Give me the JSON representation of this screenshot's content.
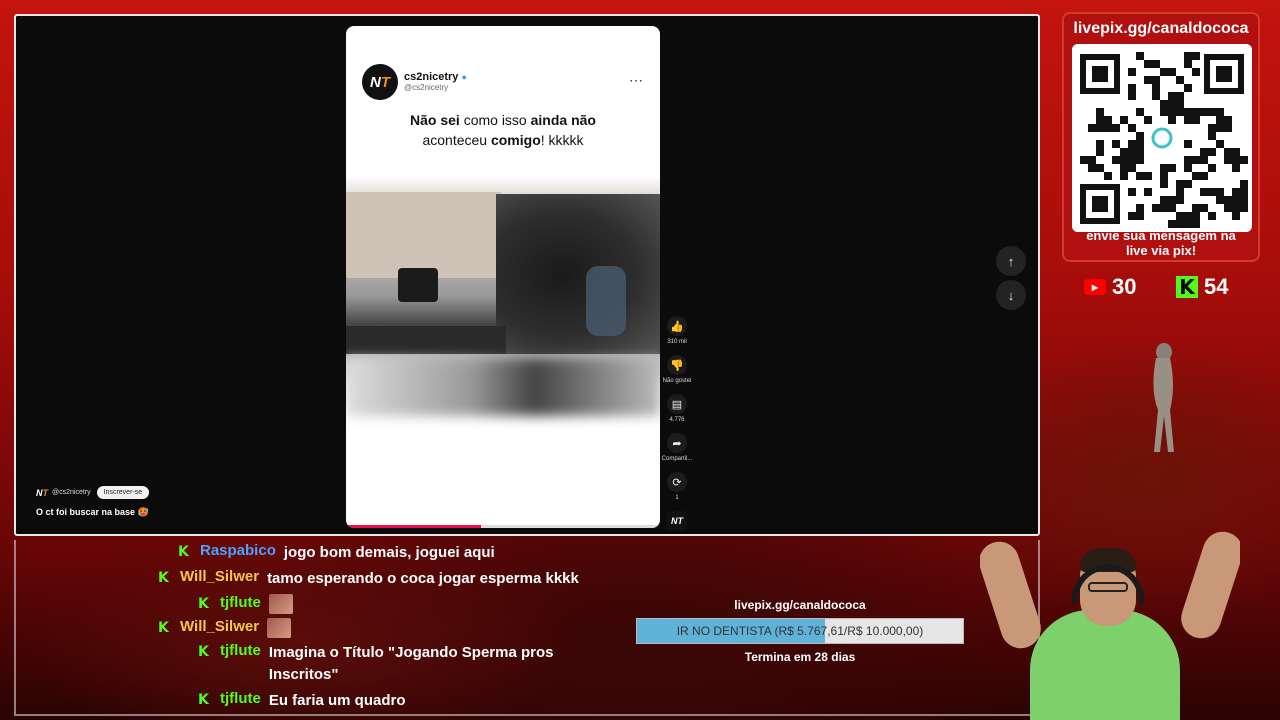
{
  "short": {
    "channel_name": "cs2nicetry",
    "channel_handle": "@cs2nicetry",
    "logo_text": "NT",
    "caption_line1_a": "Não sei",
    "caption_line1_b": " como isso ",
    "caption_line1_c": "ainda não",
    "caption_line2_a": "aconteceu ",
    "caption_line2_b": "comigo",
    "caption_line2_c": "! kkkkk",
    "progress": 0.43,
    "more_icon": "⋯",
    "actions": [
      {
        "icon": "thumbs-up-icon",
        "glyph": "👍",
        "label": "310 mil"
      },
      {
        "icon": "thumbs-down-icon",
        "glyph": "👎",
        "label": "Não gostei"
      },
      {
        "icon": "comment-icon",
        "glyph": "▤",
        "label": "4.776"
      },
      {
        "icon": "share-icon",
        "glyph": "➦",
        "label": "Compartil..."
      },
      {
        "icon": "remix-icon",
        "glyph": "⟳",
        "label": "1"
      }
    ]
  },
  "nav": {
    "up": "↑",
    "down": "↓"
  },
  "overlay": {
    "handle": "@cs2nicetry",
    "subscribe": "Inscrever-se",
    "comment": "O ct foi buscar na base 🥵"
  },
  "qr": {
    "url": "livepix.gg/canaldococa",
    "message_line1": "envie sua mensagem na",
    "message_line2": "live via pix!"
  },
  "counters": {
    "youtube": "30",
    "kick": "54",
    "youtube_color": "#ff0000",
    "kick_color": "#53fc18"
  },
  "chat": [
    {
      "user": "Raspabico",
      "color": "#4aa3ff",
      "text": "jogo bom demais, joguei aqui",
      "emote": false
    },
    {
      "user": "Will_Silwer",
      "color": "#f2c84b",
      "text": "tamo esperando o coca jogar esperma kkkk",
      "emote": false
    },
    {
      "user": "tjflute",
      "color": "#53fc18",
      "text": "",
      "emote": true
    },
    {
      "user": "Will_Silwer",
      "color": "#f2c84b",
      "text": "",
      "emote": true
    },
    {
      "user": "tjflute",
      "color": "#53fc18",
      "text": "Imagina o Título \"Jogando Sperma pros Inscritos\"",
      "emote": false
    },
    {
      "user": "tjflute",
      "color": "#53fc18",
      "text": "Eu faria um quadro",
      "emote": false
    }
  ],
  "goal": {
    "url": "livepix.gg/canaldococa",
    "label": "IR NO DENTISTA (R$ 5.767,61/R$ 10.000,00)",
    "progress": 0.5768,
    "ends": "Termina em 28 dias",
    "fill_color": "#5fb2d8"
  }
}
